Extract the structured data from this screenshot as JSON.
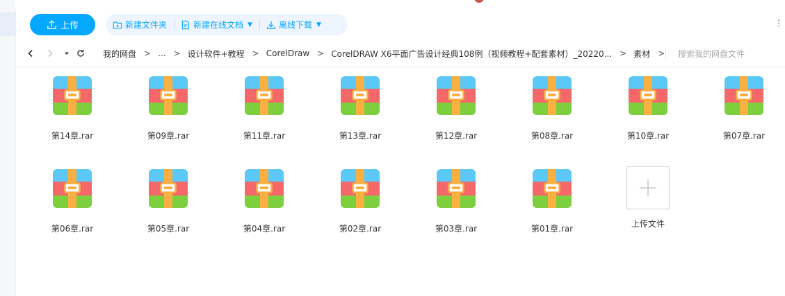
{
  "toolbar": {
    "upload_label": "上传",
    "new_folder_label": "新建文件夹",
    "new_online_doc_label": "新建在线文档",
    "offline_download_label": "离线下载",
    "menu_glyph": "⋮"
  },
  "nav": {
    "breadcrumbs": [
      "我的网盘",
      "...",
      "设计软件+教程",
      "CorelDraw",
      "CorelDRAW X6平面广告设计经典108例（视频教程+配套素材）_20220...",
      "素材"
    ],
    "sep": ">",
    "search_placeholder": "搜索我的网盘文件"
  },
  "files": [
    {
      "name": "第14章.rar"
    },
    {
      "name": "第09章.rar"
    },
    {
      "name": "第11章.rar"
    },
    {
      "name": "第13章.rar"
    },
    {
      "name": "第12章.rar"
    },
    {
      "name": "第08章.rar"
    },
    {
      "name": "第10章.rar"
    },
    {
      "name": "第07章.rar"
    },
    {
      "name": "第06章.rar"
    },
    {
      "name": "第05章.rar"
    },
    {
      "name": "第04章.rar"
    },
    {
      "name": "第02章.rar"
    },
    {
      "name": "第03章.rar"
    },
    {
      "name": "第01章.rar"
    }
  ],
  "upload_tile_label": "上传文件",
  "colors": {
    "accent": "#06a7ff",
    "archive_top": "#5bc8f5",
    "archive_mid": "#f5686a",
    "archive_bottom": "#7ecf3e",
    "archive_strap": "#f8b042"
  }
}
